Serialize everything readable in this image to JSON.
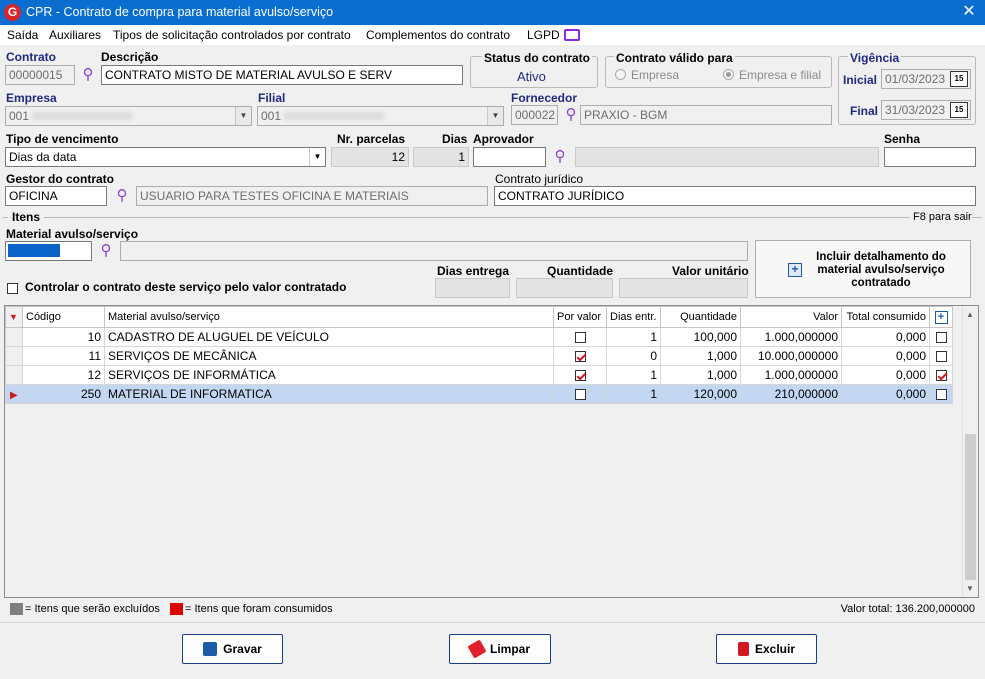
{
  "window": {
    "title": "CPR - Contrato de compra para material avulso/serviço",
    "logo": "G",
    "close": "✕"
  },
  "menu": [
    "Saída",
    "Auxiliares",
    "Tipos de solicitação controlados por contrato",
    "Complementos do contrato",
    "LGPD"
  ],
  "form": {
    "contrato_label": "Contrato",
    "contrato_value": "00000015",
    "descricao_label": "Descrição",
    "descricao_value": "CONTRATO MISTO DE MATERIAL AVULSO E SERV",
    "status_label": "Status do contrato",
    "status_value": "Ativo",
    "valido_label": "Contrato válido para",
    "valido_opt1": "Empresa",
    "valido_opt2": "Empresa e filial",
    "vigencia_label": "Vigência",
    "inicial_label": "Inicial",
    "inicial_value": "01/03/2023",
    "final_label": "Final",
    "final_value": "31/03/2023",
    "cal_text": "15",
    "empresa_label": "Empresa",
    "empresa_value": "001",
    "filial_label": "Filial",
    "filial_value": "001",
    "fornecedor_label": "Fornecedor",
    "fornecedor_code": "000022",
    "fornecedor_name": "PRAXIO - BGM",
    "tipo_venc_label": "Tipo de vencimento",
    "tipo_venc_value": "Dias da data",
    "nr_parcelas_label": "Nr. parcelas",
    "nr_parcelas_value": "12",
    "dias_label": "Dias",
    "dias_value": "1",
    "aprovador_label": "Aprovador",
    "aprovador_value": "",
    "senha_label": "Senha",
    "senha_value": "",
    "gestor_label": "Gestor do contrato",
    "gestor_value": "OFICINA",
    "gestor_desc": "USUARIO PARA TESTES OFICINA E MATERIAIS",
    "juridico_label": "Contrato jurídico",
    "juridico_value": "CONTRATO JURÍDICO"
  },
  "itens": {
    "label": "Itens",
    "hint": "F8 para sair",
    "material_label": "Material avulso/serviço",
    "controlar_label": "Controlar o contrato deste serviço pelo valor contratado",
    "dias_entrega_label": "Dias entrega",
    "quantidade_label": "Quantidade",
    "valor_unitario_label": "Valor unitário",
    "incluir_button": "Incluir detalhamento do material avulso/serviço contratado"
  },
  "grid": {
    "columns": [
      "Código",
      "Material avulso/serviço",
      "Por valor",
      "Dias entr.",
      "Quantidade",
      "Valor",
      "Total consumido"
    ],
    "rows": [
      {
        "codigo": "10",
        "material": "CADASTRO DE ALUGUEL DE VEÍCULO",
        "por_valor": false,
        "dias": "1",
        "quantidade": "100,000",
        "valor": "1.000,000000",
        "total": "0,000",
        "consumido": false
      },
      {
        "codigo": "11",
        "material": "SERVIÇOS DE MECÂNICA",
        "por_valor": true,
        "dias": "0",
        "quantidade": "1,000",
        "valor": "10.000,000000",
        "total": "0,000",
        "consumido": false
      },
      {
        "codigo": "12",
        "material": "SERVIÇOS DE INFORMÁTICA",
        "por_valor": true,
        "dias": "1",
        "quantidade": "1,000",
        "valor": "1.000,000000",
        "total": "0,000",
        "consumido": true
      },
      {
        "codigo": "250",
        "material": "MATERIAL DE INFORMATICA",
        "por_valor": false,
        "dias": "1",
        "quantidade": "120,000",
        "valor": "210,000000",
        "total": "0,000",
        "consumido": false
      }
    ]
  },
  "legend": {
    "excluidos": "= Itens que serão excluídos",
    "consumidos": "= Itens que foram consumidos",
    "valor_total": "Valor total: 136.200,000000"
  },
  "buttons": {
    "gravar": "Gravar",
    "limpar": "Limpar",
    "excluir": "Excluir"
  },
  "colors": {
    "title_bar": "#0a6ed1",
    "selected_row": "#c3d7f2",
    "consumed": "#e00000",
    "excluded": "#7f7f7f"
  }
}
